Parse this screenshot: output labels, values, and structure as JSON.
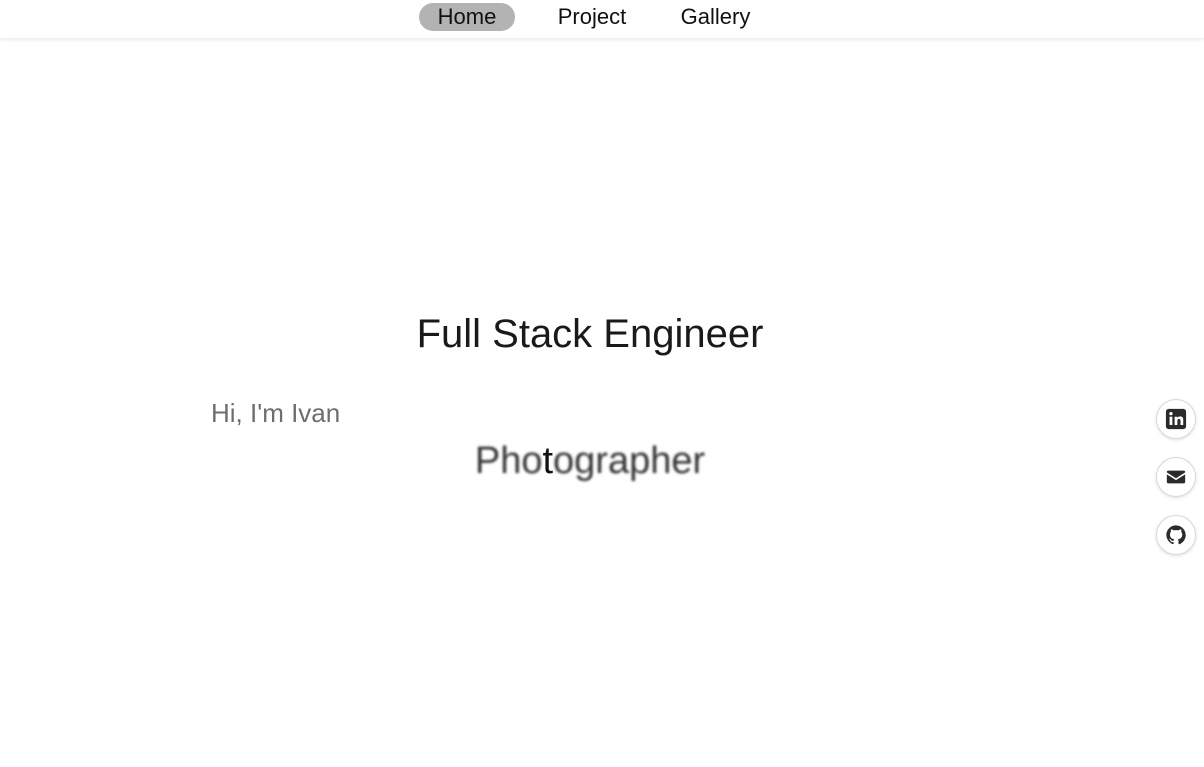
{
  "nav": {
    "items": [
      {
        "label": "Home",
        "active": true
      },
      {
        "label": "Project",
        "active": false
      },
      {
        "label": "Gallery",
        "active": false
      }
    ],
    "active_bg": "#b3b3b3"
  },
  "hero": {
    "title": "Full Stack Engineer",
    "greeting": "Hi, I'm Ivan",
    "role_parts": {
      "before": "Pho",
      "highlight": "t",
      "after": "ographer"
    }
  },
  "social": {
    "icons": [
      "linkedin-icon",
      "email-icon",
      "github-icon"
    ]
  }
}
